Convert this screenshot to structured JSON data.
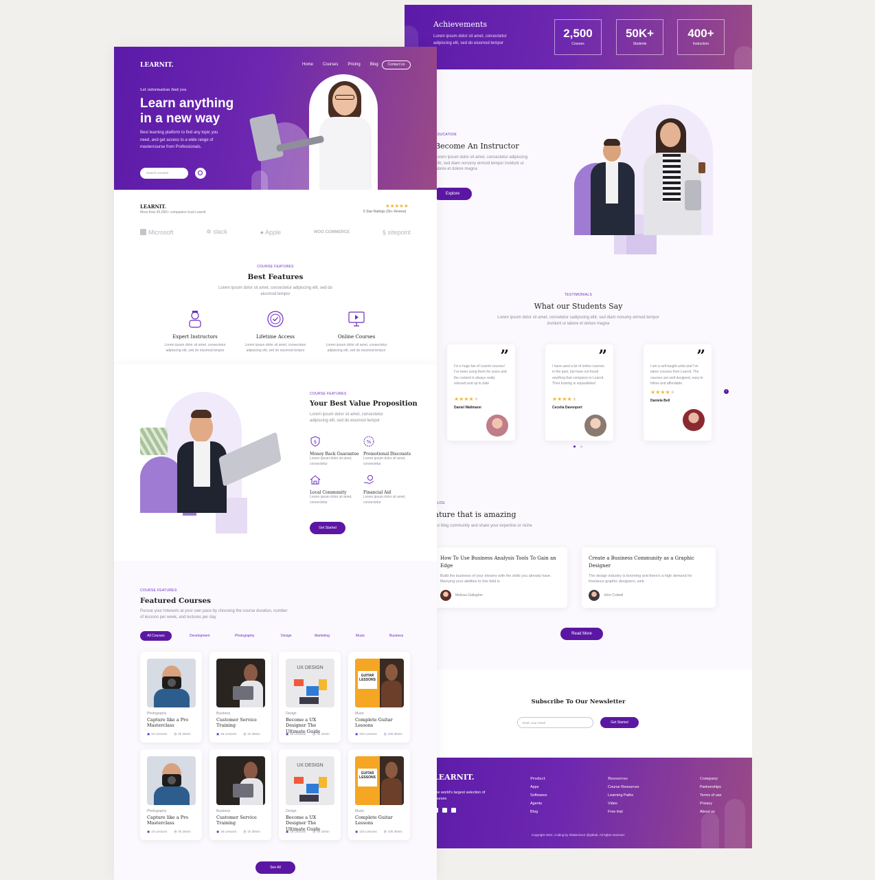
{
  "brand": "LEARNIT.",
  "nav": {
    "items": [
      "Home",
      "Courses",
      "Pricing",
      "Blog"
    ],
    "contact": "Contact Us"
  },
  "hero": {
    "kicker": "Let information find you",
    "title_line1": "Learn anything",
    "title_line2": "in a new way",
    "desc": "Best learning platform to find any topic you need, and get access to a wide range of mastercourse from Professionals.",
    "search_placeholder": "Search Courses"
  },
  "trust": {
    "brand": "LEARNIT.",
    "text": "More than 45,000+ companies trust Learnit",
    "rating": "5 Star Ratings (2k+ Review)",
    "logos": [
      "Microsoft",
      "slack",
      "Apple",
      "WOO COMMERCE",
      "sitepoint"
    ]
  },
  "features": {
    "kicker": "COURSE FEATURES",
    "title": "Best Features",
    "desc": "Lorem ipsum dolor sit amet, consectetur adipiscing elit, sed do eiusmod tempor",
    "items": [
      {
        "title": "Expert Instructors",
        "desc": "Lorem ipsum dolor sit amet, consectetur adipiscing elit, sed do eiusmod tempor",
        "icon": "instructor-icon"
      },
      {
        "title": "Lifetime Access",
        "desc": "Lorem ipsum dolor sit amet, consectetur adipiscing elit, sed do eiusmod tempor",
        "icon": "badge-check-icon"
      },
      {
        "title": "Online Courses",
        "desc": "Lorem ipsum dolor sit amet, consectetur adipiscing elit, sed do eiusmod tempor",
        "icon": "monitor-play-icon"
      }
    ]
  },
  "value": {
    "kicker": "COURSE FEATURES",
    "title": "Your Best Value Proposition",
    "desc": "Lorem ipsum dolor sit amet, consectetur adipiscing elit, sed do eiusmod tempor",
    "items": [
      {
        "title": "Money Back Guarantee",
        "desc": "Lorem ipsum dolor sit amet, consectetur"
      },
      {
        "title": "Promotional Discounts",
        "desc": "Lorem ipsum dolor sit amet, consectetur"
      },
      {
        "title": "Local Community",
        "desc": "Lorem ipsum dolor sit amet, consectetur"
      },
      {
        "title": "Financial Aid",
        "desc": "Lorem ipsum dolor sit amet, consectetur"
      }
    ],
    "button": "Get Started"
  },
  "courses": {
    "kicker": "COURSE FEATURES",
    "title": "Featured Courses",
    "desc": "Pursue your interests at your own pace by choosing the course duration, number of lessons per week, and lectures per day",
    "tabs": [
      "All Courses",
      "Development",
      "Photography",
      "Design",
      "Marketing",
      "Music",
      "Business"
    ],
    "cards": [
      {
        "cat": "Photography",
        "title": "Capture like a Pro Masterclass",
        "lessons": "10 Lessons",
        "time": "0h 25min"
      },
      {
        "cat": "Business",
        "title": "Customer Service Training",
        "lessons": "26 Lessons",
        "time": "1h 30min"
      },
      {
        "cat": "Design",
        "title": "Become a UX Designer The Ultimate Guide",
        "lessons": "15 Lessons",
        "time": "0h 22min"
      },
      {
        "cat": "Music",
        "title": "Complete Guitar Lessons",
        "lessons": "102 Lessons",
        "time": "10h 30min"
      },
      {
        "cat": "Photography",
        "title": "Capture like a Pro Masterclass",
        "lessons": "10 Lessons",
        "time": "0h 25min"
      },
      {
        "cat": "Business",
        "title": "Customer Service Training",
        "lessons": "26 Lessons",
        "time": "1h 30min"
      },
      {
        "cat": "Design",
        "title": "Become a UX Designer The Ultimate Guide",
        "lessons": "15 Lessons",
        "time": "0h 22min"
      },
      {
        "cat": "Music",
        "title": "Complete Guitar Lessons",
        "lessons": "102 Lessons",
        "time": "10h 30min"
      }
    ],
    "thumb_ux": "UX DESIGN",
    "thumb_guitar": "GUITAR LESSONS",
    "see_all": "See All"
  },
  "achievements": {
    "title": "Achievements",
    "desc": "Lorem ipsum dolor sit amet, consectetur adipiscing elit, sed do eiusmod tempor",
    "stats": [
      {
        "value": "2,500",
        "label": "Courses"
      },
      {
        "value": "50K+",
        "label": "Students"
      },
      {
        "value": "400+",
        "label": "Instructors"
      }
    ]
  },
  "instructor": {
    "kicker": "EDUCATION",
    "title": "Become An Instructor",
    "desc": "Lorem ipsum dolor sit amet, consectetur adipiscing elitr, sed diam nonumy eirmod tempor invidunt ut labore et dolore magna",
    "button": "Explore"
  },
  "testimonials": {
    "kicker": "TESTIMONIALS",
    "title": "What our Students Say",
    "desc": "Lorem ipsum dolor sit amet, consetetur sadipscing elitr, sed diam nonumy eirmod tempor invidunt ut labore et dolore magna",
    "items": [
      {
        "text": "I'm a huge fan of Learnit courses! I've been using them for years and the content is always really relevant and up to date",
        "name": "Daniel Wallmann",
        "rating": 4
      },
      {
        "text": "I have used a lot of online courses in the past, but have not found anything that compares to Learnit. Their training is unparalleled",
        "name": "Cecelia Davenport",
        "rating": 4
      },
      {
        "text": "I am a self-taught artist and I've taken courses from Learnit. The courses are well designed, easy to follow and affordable.",
        "name": "Daniela Bell",
        "rating": 4
      }
    ]
  },
  "blog": {
    "kicker": "OUR BLOG",
    "title": "Feature that is amazing",
    "desc": "Join our blog community and share your expertise or niche",
    "posts": [
      {
        "title": "How To Use Business Analysis Tools To Gain an Edge",
        "desc": "Build the business of your dreams with the skills you already have. Marrying your abilities to this field is",
        "author": "Melissa Gallagher"
      },
      {
        "title": "Create a Business Community as a Graphic Designer",
        "desc": "The design industry is booming and there's a high demand for freelance graphic designers, web",
        "author": "John Colwell"
      }
    ],
    "button": "Read More"
  },
  "newsletter": {
    "title": "Subscribe To Our Newsletter",
    "placeholder": "Enter your email",
    "button": "Get Started"
  },
  "footer": {
    "brand": "LEARNIT.",
    "tagline": "The world's largest selection of courses",
    "columns": [
      {
        "title": "Product",
        "links": [
          "Apps",
          "Softwares",
          "Agents",
          "Blog"
        ]
      },
      {
        "title": "Resources",
        "links": [
          "Course Resources",
          "Learning Paths",
          "Video",
          "Free trial"
        ]
      },
      {
        "title": "Company",
        "links": [
          "Partnerships",
          "Terms of use",
          "Privacy",
          "About us"
        ]
      }
    ],
    "copyright": "Copyright 2022, Coding by Shabmirs12 @github. All rights reserved."
  },
  "colors": {
    "primary": "#5b17a3",
    "accent_end": "#9a4a86",
    "star": "#f3b62c",
    "background": "#f1f0ec"
  }
}
